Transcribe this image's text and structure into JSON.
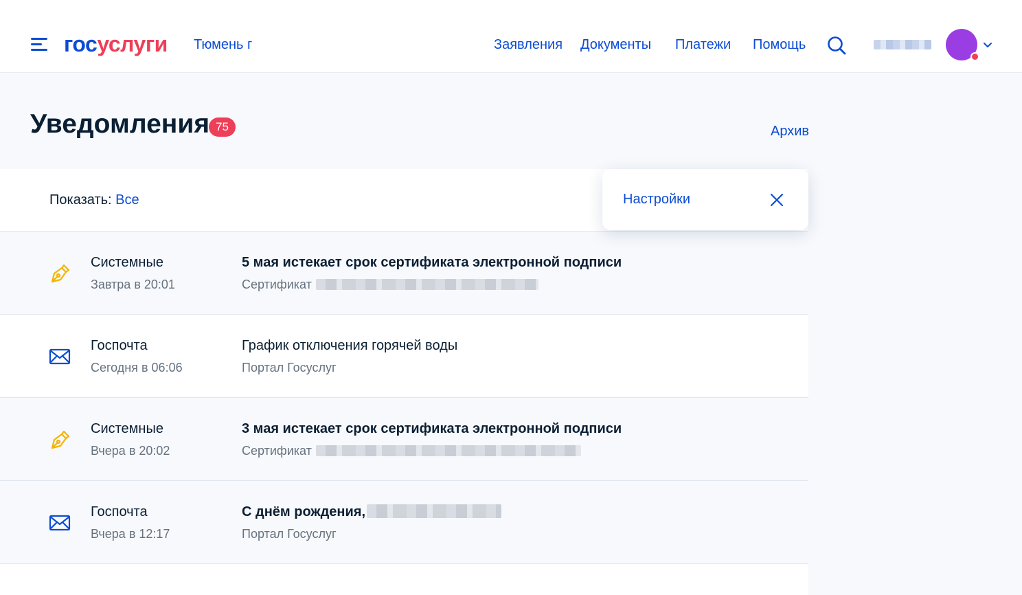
{
  "header": {
    "logo_part1": "гос",
    "logo_part2": "услуги",
    "city": "Тюмень г",
    "nav": [
      "Заявления",
      "Документы",
      "Платежи",
      "Помощь"
    ],
    "brand_color": "#0d4cd3",
    "accent_color": "#ee3f58",
    "avatar_color": "#9a3de3"
  },
  "page": {
    "title": "Уведомления",
    "count": "75",
    "archive_label": "Архив"
  },
  "filter": {
    "label": "Показать:",
    "value": "Все"
  },
  "settings_popover": {
    "label": "Настройки"
  },
  "notifications": [
    {
      "icon": "pen-nib-icon",
      "category": "Системные",
      "time": "Завтра в 20:01",
      "title": "5 мая истекает срок сертификата электронной подписи",
      "subtitle": "Сертификат",
      "unread": true
    },
    {
      "icon": "envelope-icon",
      "category": "Госпочта",
      "time": "Сегодня в 06:06",
      "title": "График отключения горячей воды",
      "subtitle": "Портал Госуслуг",
      "unread": false
    },
    {
      "icon": "pen-nib-icon",
      "category": "Системные",
      "time": "Вчера в 20:02",
      "title": "3 мая истекает срок сертификата электронной подписи",
      "subtitle": "Сертификат",
      "unread": true
    },
    {
      "icon": "envelope-icon",
      "category": "Госпочта",
      "time": "Вчера в 12:17",
      "title": "С днём рождения,",
      "subtitle": "Портал Госуслуг",
      "unread": true
    }
  ]
}
